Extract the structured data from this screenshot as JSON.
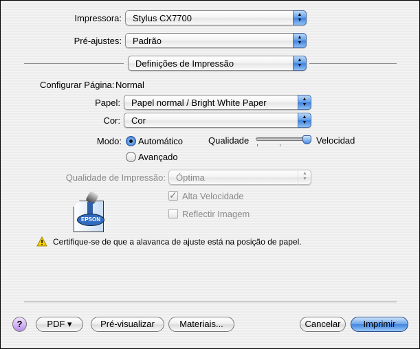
{
  "printer": {
    "label": "Impressora:",
    "value": "Stylus CX7700"
  },
  "presets": {
    "label": "Pré-ajustes:",
    "value": "Padrão"
  },
  "panel": {
    "value": "Definições de Impressão"
  },
  "page_setup": {
    "label": "Configurar Página:",
    "value": "Normal"
  },
  "paper": {
    "label": "Papel:",
    "value": "Papel normal / Bright White Paper"
  },
  "color": {
    "label": "Cor:",
    "value": "Cor"
  },
  "mode": {
    "label": "Modo:",
    "options": [
      {
        "label": "Automático",
        "selected": true
      },
      {
        "label": "Avançado",
        "selected": false
      }
    ]
  },
  "slider": {
    "left_label": "Qualidade",
    "right_label": "Velocidad",
    "value_fraction": 1.0,
    "ticks": 3
  },
  "print_quality": {
    "label": "Qualidade de Impressão:",
    "value": "Óptima",
    "disabled": true
  },
  "checkboxes": [
    {
      "label": "Alta Velocidade",
      "checked": true,
      "disabled": true
    },
    {
      "label": "Reflectir Imagem",
      "checked": false,
      "disabled": true
    }
  ],
  "logo": {
    "text": "EPSON"
  },
  "warning": {
    "icon": "warning-triangle-icon",
    "text": "Certifique-se de que a alavanca de ajuste está na posição de papel."
  },
  "buttons": {
    "help": "?",
    "pdf": "PDF ▾",
    "preview": "Pré-visualizar",
    "supplies": "Materiais...",
    "cancel": "Cancelar",
    "print": "Imprimir"
  },
  "colors": {
    "accent": "#3f84e0",
    "warning": "#f5d100"
  }
}
